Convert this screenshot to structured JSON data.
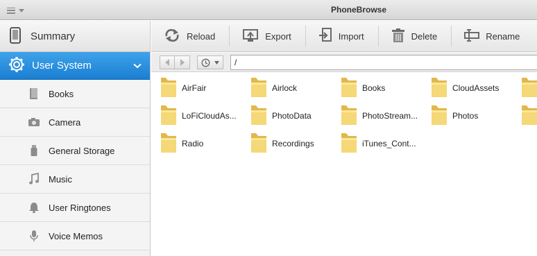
{
  "window": {
    "title": "PhoneBrowse"
  },
  "sidebar": {
    "summary_label": "Summary",
    "section_label": "User System",
    "items": [
      {
        "label": "Books",
        "icon": "book-icon"
      },
      {
        "label": "Camera",
        "icon": "camera-icon"
      },
      {
        "label": "General Storage",
        "icon": "usb-drive-icon"
      },
      {
        "label": "Music",
        "icon": "music-note-icon"
      },
      {
        "label": "User Ringtones",
        "icon": "bell-icon"
      },
      {
        "label": "Voice Memos",
        "icon": "microphone-icon"
      }
    ]
  },
  "toolbar": {
    "reload_label": "Reload",
    "export_label": "Export",
    "import_label": "Import",
    "delete_label": "Delete",
    "rename_label": "Rename"
  },
  "navbar": {
    "path": "/"
  },
  "files": [
    "AirFair",
    "Airlock",
    "Books",
    "CloudAssets",
    "",
    "LoFiCloudAs...",
    "PhotoData",
    "PhotoStream...",
    "Photos",
    "",
    "Radio",
    "Recordings",
    "iTunes_Cont..."
  ],
  "colors": {
    "accent": "#2a8fe0",
    "folder": "#f2d06b"
  }
}
